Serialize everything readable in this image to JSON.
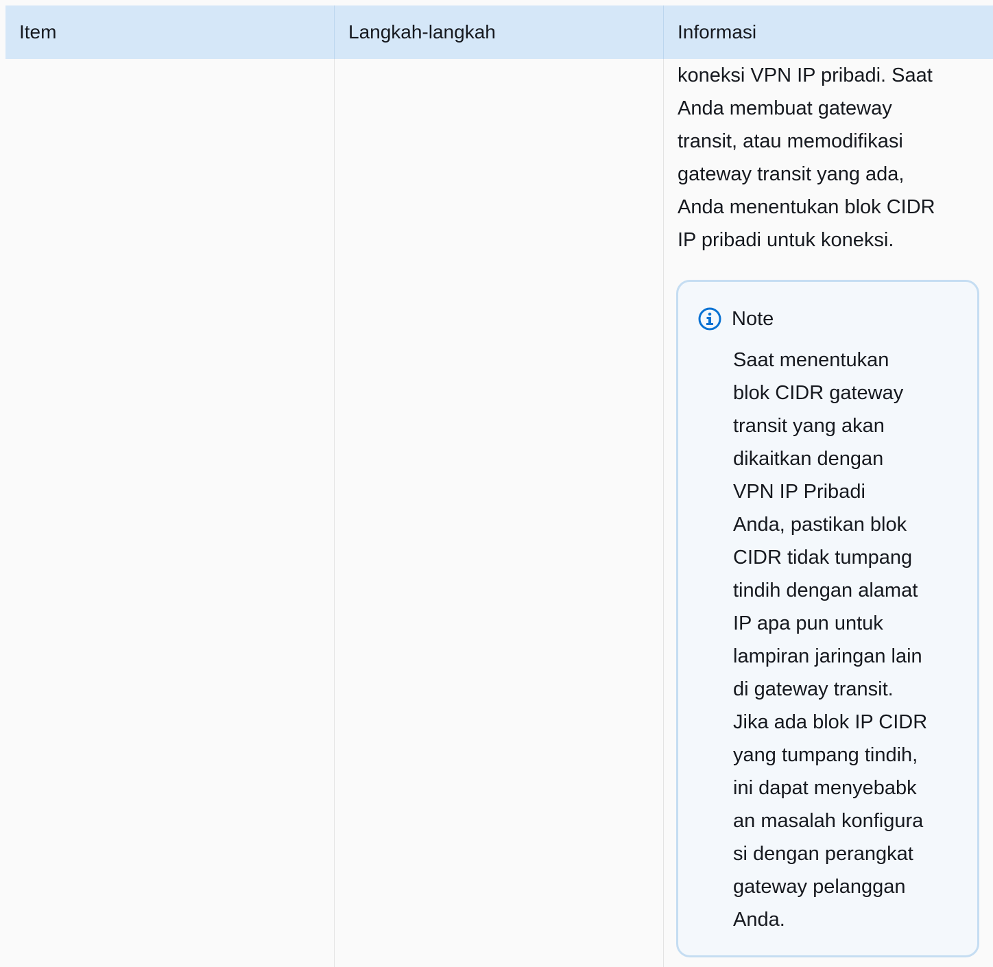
{
  "table": {
    "headers": [
      "Item",
      "Langkah-langkah",
      "Informasi"
    ],
    "row": {
      "item": "",
      "steps": "",
      "info_lines": [
        "koneksi VPN IP pribadi. Saat",
        "Anda membuat gateway",
        "transit, atau memodifikasi",
        "gateway transit yang ada,",
        "Anda menentukan blok CIDR",
        "IP pribadi untuk koneksi."
      ],
      "note": {
        "icon": "info-circle-icon",
        "title": "Note",
        "body_lines": [
          "Saat menentukan",
          "blok CIDR gateway",
          "transit yang akan",
          "dikaitkan dengan",
          "VPN IP Pribadi",
          "Anda, pastikan blok",
          "CIDR tidak tumpang",
          "tindih dengan alamat",
          "IP apa pun untuk",
          "lampiran jaringan lain",
          "di gateway transit.",
          "Jika ada blok IP CIDR",
          "yang tumpang tindih,",
          "ini dapat menyebabk",
          "an masalah konfigura",
          "si dengan perangkat",
          "gateway pelanggan",
          "Anda."
        ]
      }
    }
  },
  "colors": {
    "header_bg": "#d5e7f8",
    "cell_bg": "#fafafa",
    "note_border": "#c5ddf2",
    "icon_blue": "#0972d3"
  }
}
